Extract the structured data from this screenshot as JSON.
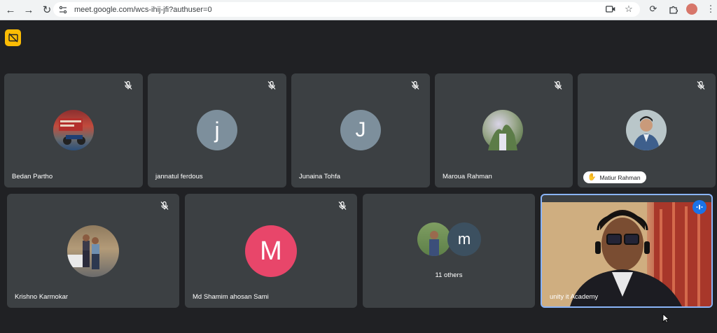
{
  "browser": {
    "url": "meet.google.com/wcs-ihij-jfi?authuser=0"
  },
  "colors": {
    "background": "#202124",
    "tile": "#3c4043",
    "badge": "#fbbc04",
    "accent": "#8ab4f8",
    "speaking": "#1a73e8"
  },
  "participants_row1": [
    {
      "name": "Bedan Partho",
      "avatar": "photo"
    },
    {
      "name": "jannatul ferdous",
      "avatar": "letter",
      "initial": "j",
      "color": "#7d8f9c"
    },
    {
      "name": "Junaina Tohfa",
      "avatar": "letter",
      "initial": "J",
      "color": "#7d8f9c"
    },
    {
      "name": "Maroua Rahman",
      "avatar": "photo"
    },
    {
      "name": "Matiur Rahman",
      "avatar": "photo",
      "hand_raised": true
    }
  ],
  "participants_row2": [
    {
      "name": "Krishno Karmokar",
      "avatar": "photo"
    },
    {
      "name": "Md Shamim ahosan Sami",
      "avatar": "letter",
      "initial": "M",
      "color": "#e8466a"
    },
    {
      "others_label": "11 others",
      "initial": "m",
      "color": "#3c5060"
    },
    {
      "name": "unity it Academy",
      "avatar": "video",
      "speaking": true
    }
  ]
}
